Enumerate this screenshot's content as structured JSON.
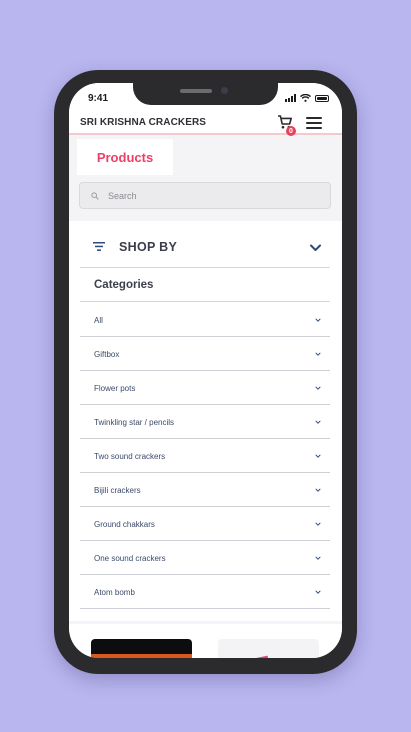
{
  "status_bar": {
    "time": "9:41",
    "icons": [
      "signal-icon",
      "wifi-icon",
      "battery-icon"
    ]
  },
  "header": {
    "brand": "SRI KRISHNA CRACKERS",
    "cart_count": "0",
    "icons": [
      "cart-icon",
      "hamburger-menu-icon"
    ]
  },
  "tabs": {
    "products_label": "Products"
  },
  "search": {
    "placeholder": "Search",
    "value": ""
  },
  "filters": {
    "shop_by_label": "SHOP BY",
    "categories_label": "Categories",
    "category_items": [
      {
        "label": "All"
      },
      {
        "label": "Giftbox"
      },
      {
        "label": "Flower pots"
      },
      {
        "label": "Twinkling star / pencils"
      },
      {
        "label": "Two sound crackers"
      },
      {
        "label": "Bijili crackers"
      },
      {
        "label": "Ground chakkars"
      },
      {
        "label": "One sound crackers"
      },
      {
        "label": "Atom bomb"
      }
    ]
  },
  "colors": {
    "background": "#b8b5ef",
    "accent": "#ee3f66",
    "badge": "#e8425a",
    "category_text": "#3b4a6a",
    "chevron": "#2f4a7a"
  }
}
